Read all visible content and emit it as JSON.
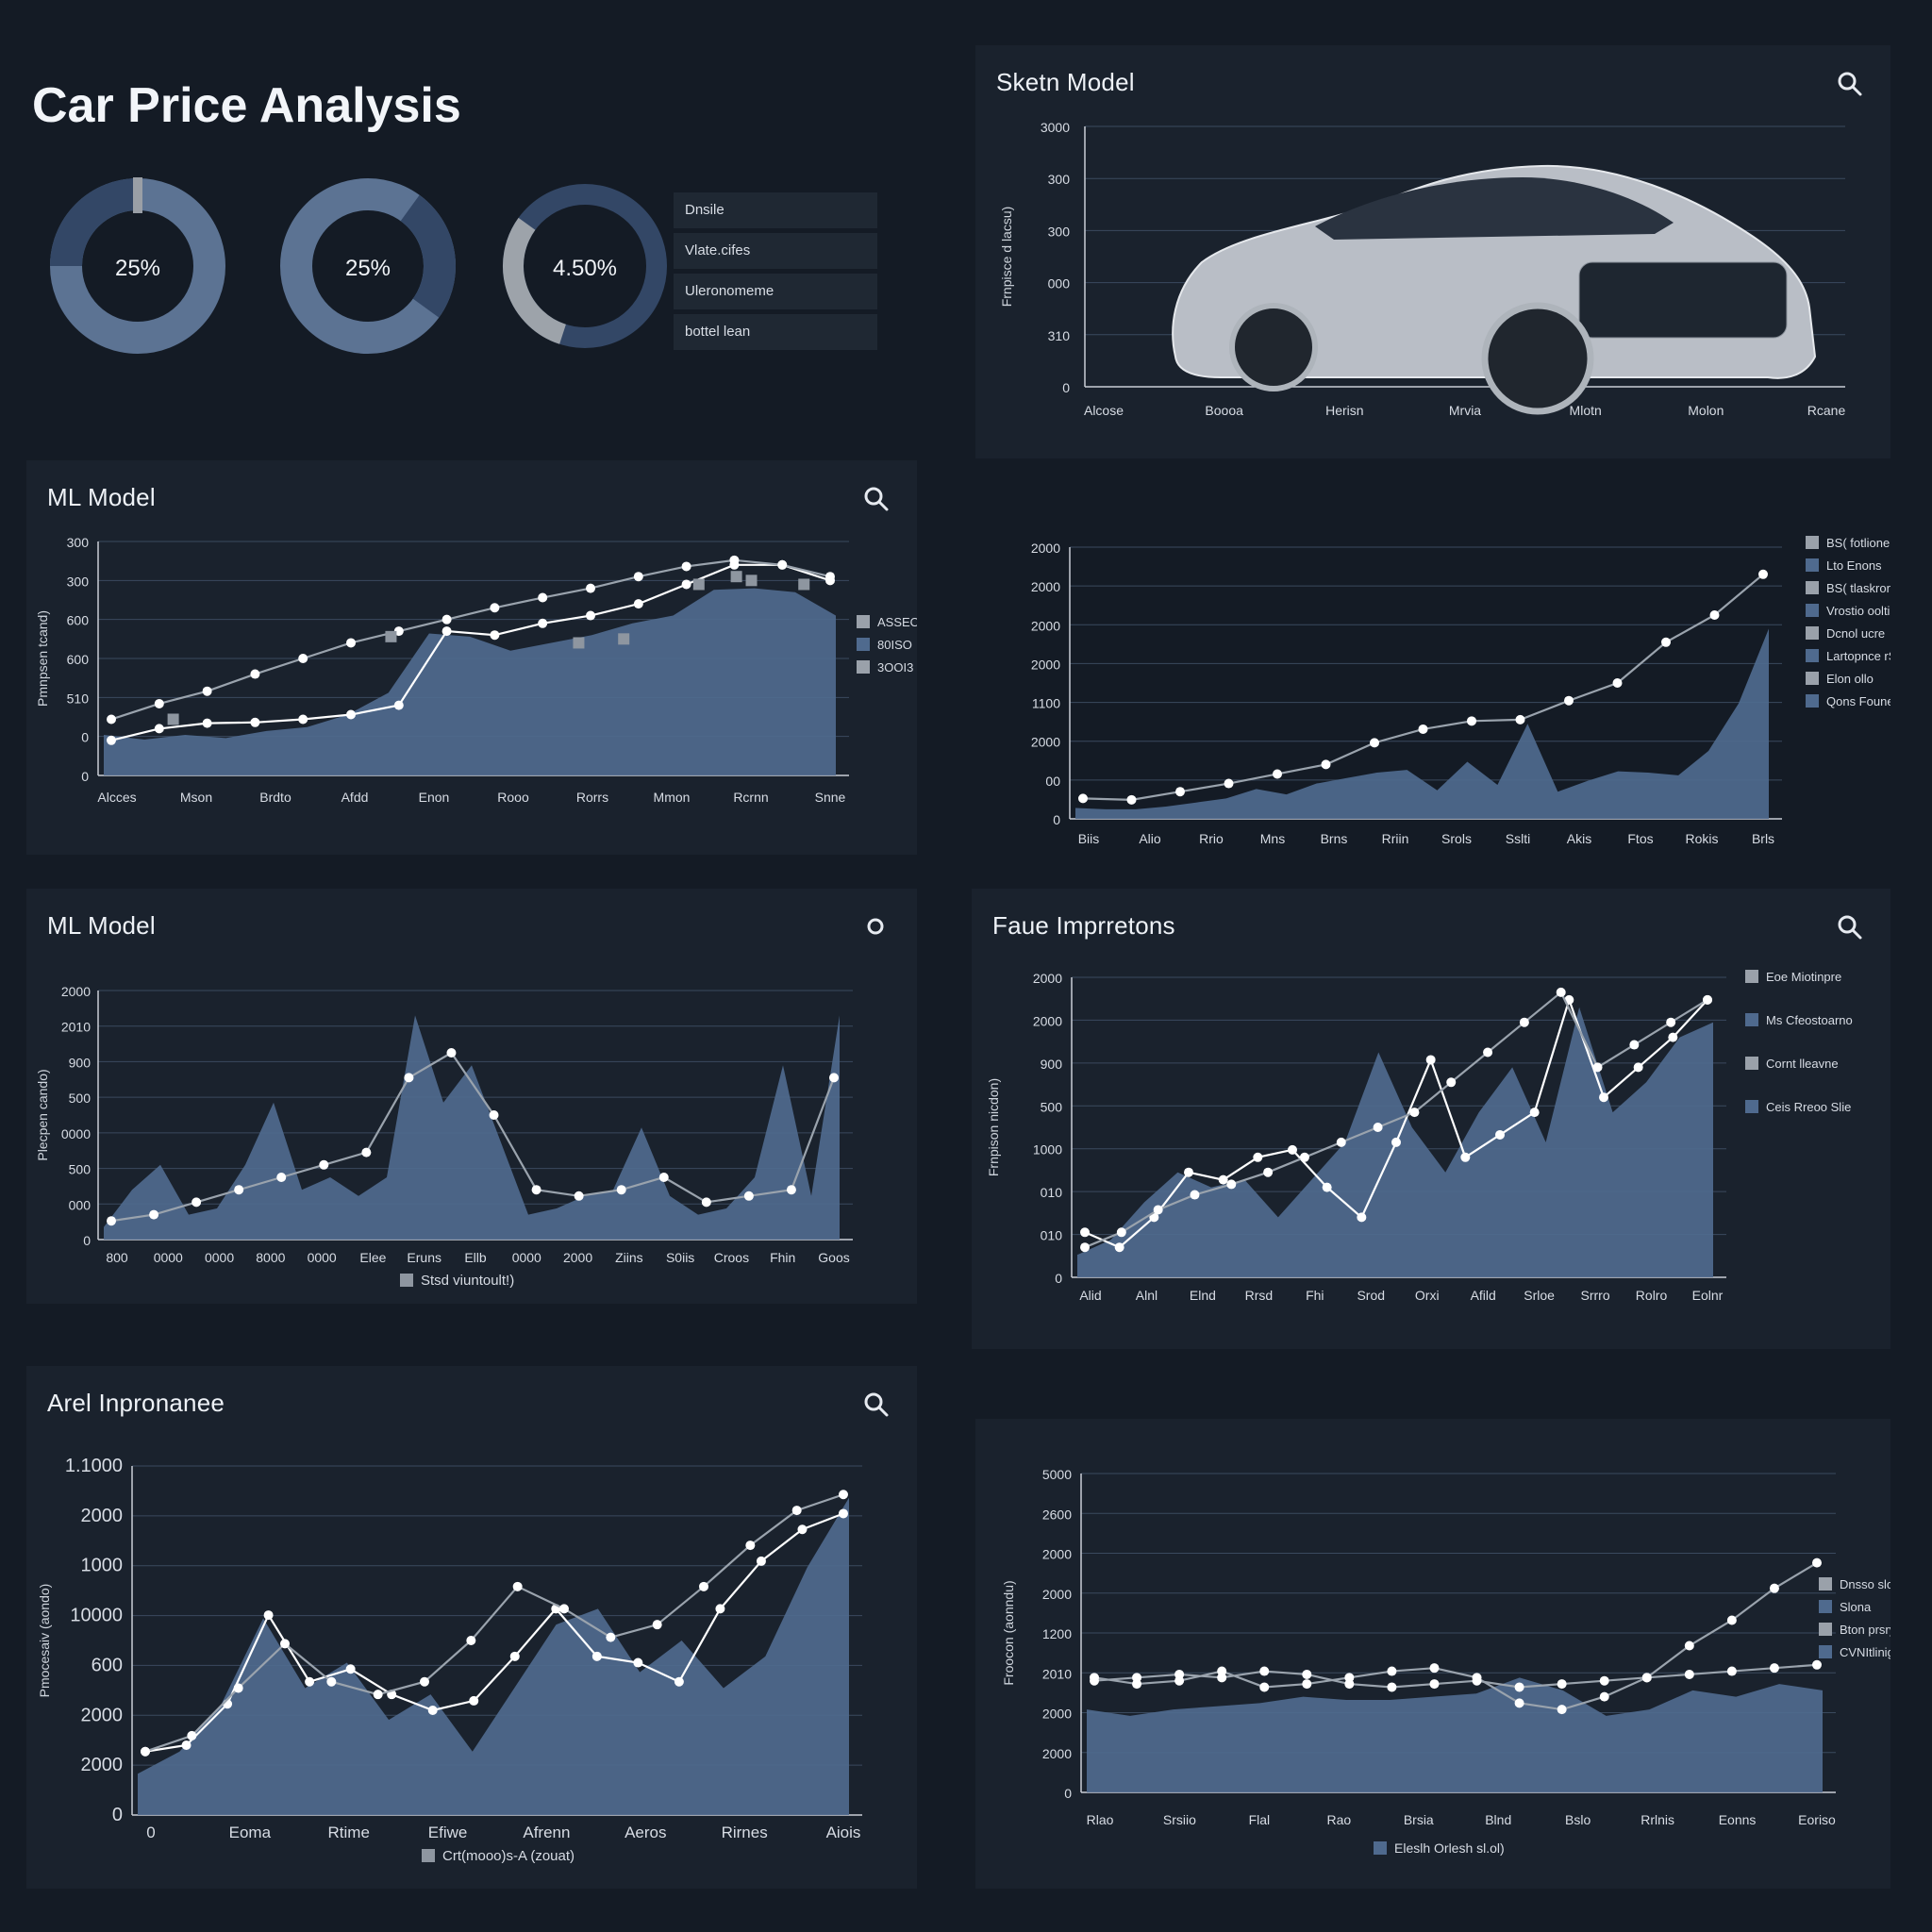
{
  "title": "Car Price Analysis",
  "gauges": [
    {
      "label": "25%",
      "fraction": 0.25
    },
    {
      "label": "25%",
      "fraction": 0.25
    },
    {
      "label": "4.50%",
      "fraction": 0.3
    }
  ],
  "gauge_legend": [
    "Dnsile",
    "Vlate.cifes",
    "Uleronomeme",
    "bottel lean"
  ],
  "colors": {
    "fill": "#4f6a8e",
    "line_white": "#ffffff",
    "line_gray": "#9aa3ad",
    "grid": "#3a4a5e",
    "bg": "#141b25",
    "panel": "#1a222d"
  },
  "icons": {
    "search": "search-icon"
  },
  "chart_data": [
    {
      "type": "bar",
      "panel_title": "Sketn Model",
      "ylabel": "Frnpisce d lacsu)",
      "categories": [
        "Alcose",
        "Boooa",
        "Herisn",
        "Mrvia",
        "Mlotn",
        "Molon",
        "Rcane"
      ],
      "y_ticks": [
        "3000",
        "300",
        "300",
        "000",
        "310",
        "0"
      ],
      "image": "car-photo"
    },
    {
      "type": "area",
      "panel_title": "ML Model",
      "ylabel": "Pmnpsen tcand)",
      "categories": [
        "Alcces",
        "Mson",
        "Brdto",
        "Afdd",
        "Enon",
        "Rooo",
        "Rorrs",
        "Mmon",
        "Rcrnn",
        "Snne"
      ],
      "y_ticks": [
        "300",
        "300",
        "600",
        "600",
        "510",
        "0",
        "0"
      ],
      "ylim": [
        0,
        300
      ],
      "area": [
        52,
        46,
        52,
        48,
        57,
        62,
        78,
        106,
        182,
        178,
        160,
        170,
        180,
        195,
        205,
        238,
        240,
        235,
        205
      ],
      "series": [
        {
          "color": "white",
          "values": [
            45,
            60,
            67,
            68,
            72,
            78,
            90,
            185,
            180,
            195,
            205,
            220,
            245,
            270,
            270,
            250
          ]
        },
        {
          "color": "gray",
          "values": [
            72,
            92,
            108,
            130,
            150,
            170,
            185,
            200,
            215,
            228,
            240,
            255,
            268,
            276,
            270,
            255
          ]
        }
      ],
      "markers_gray": [
        [
          0.1,
          72
        ],
        [
          0.39,
          178
        ],
        [
          0.64,
          170
        ],
        [
          0.7,
          175
        ],
        [
          0.8,
          245
        ],
        [
          0.85,
          255
        ],
        [
          0.87,
          250
        ],
        [
          0.94,
          245
        ]
      ],
      "legend": [
        "ASSEO",
        "80ISO",
        "3OOI3"
      ]
    },
    {
      "type": "area",
      "panel_title": "",
      "categories": [
        "Biis",
        "Alio",
        "Rrio",
        "Mns",
        "Brns",
        "Rriin",
        "Srols",
        "Sslti",
        "Akis",
        "Ftos",
        "Rokis",
        "Brls"
      ],
      "y_ticks": [
        "2000",
        "2000",
        "2000",
        "2000",
        "1100",
        "2000",
        "00",
        "0"
      ],
      "ylim": [
        0,
        2000
      ],
      "area": [
        80,
        70,
        70,
        90,
        120,
        150,
        220,
        180,
        260,
        300,
        340,
        360,
        210,
        420,
        250,
        700,
        200,
        280,
        350,
        340,
        320,
        500,
        850,
        1400
      ],
      "series": [
        {
          "color": "gray",
          "values": [
            150,
            140,
            200,
            260,
            330,
            400,
            560,
            660,
            720,
            730,
            870,
            1000,
            1300,
            1500,
            1800
          ]
        }
      ],
      "legend": [
        "BS( fotlione",
        "Lto Enons",
        "BS( tlaskronsy",
        "Vrostio ooltis",
        "Dcnol ucre",
        "Lartopnce rShl",
        "Elon ollo",
        "Qons Foune"
      ]
    },
    {
      "type": "area",
      "panel_title": "ML Model",
      "ylabel": "Plecpen cando)",
      "categories": [
        "800",
        "0000",
        "0000",
        "8000",
        "0000",
        "Elee",
        "Eruns",
        "Ellb",
        "0000",
        "2000",
        "Ziins",
        "S0iis",
        "Croos",
        "Fhin",
        "Goos"
      ],
      "y_ticks": [
        "2000",
        "2010",
        "900",
        "500",
        "0000",
        "500",
        "000",
        "0"
      ],
      "ylim": [
        0,
        2000
      ],
      "area": [
        100,
        400,
        600,
        200,
        250,
        600,
        1100,
        400,
        500,
        350,
        500,
        1800,
        1100,
        1400,
        800,
        200,
        250,
        350,
        400,
        900,
        350,
        200,
        250,
        500,
        1400,
        350,
        1800
      ],
      "series": [
        {
          "color": "gray",
          "values": [
            150,
            200,
            300,
            400,
            500,
            600,
            700,
            1300,
            1500,
            1000,
            400,
            350,
            400,
            500,
            300,
            350,
            400,
            1300
          ]
        }
      ],
      "legend": [
        "Stsd viuntoult!)"
      ]
    },
    {
      "type": "area",
      "panel_title": "Faue Imprretons",
      "ylabel": "Frnpison nicdon)",
      "categories": [
        "Alid",
        "Alnl",
        "Elnd",
        "Rrsd",
        "Fhi",
        "Srod",
        "Orxi",
        "Afild",
        "Srloe",
        "Srrro",
        "Rolro",
        "Eolnr"
      ],
      "y_ticks": [
        "2000",
        "2000",
        "900",
        "500",
        "1000",
        "010",
        "010",
        "0"
      ],
      "ylim": [
        0,
        2000
      ],
      "area": [
        150,
        250,
        500,
        700,
        600,
        650,
        400,
        650,
        900,
        1500,
        1000,
        700,
        1100,
        1400,
        900,
        1800,
        1100,
        1300,
        1600,
        1700
      ],
      "series": [
        {
          "color": "white",
          "values": [
            300,
            200,
            400,
            700,
            650,
            800,
            850,
            600,
            400,
            900,
            1450,
            800,
            950,
            1100,
            1850,
            1200,
            1400,
            1600,
            1850
          ]
        },
        {
          "color": "gray",
          "values": [
            200,
            300,
            450,
            550,
            620,
            700,
            800,
            900,
            1000,
            1100,
            1300,
            1500,
            1700,
            1900,
            1400,
            1550,
            1700,
            1850
          ]
        }
      ],
      "legend": [
        "Eoe Miotinpre",
        "Ms Cfeostoarno",
        "Cornt lleavne",
        "Ceis Rreoo Slie"
      ]
    },
    {
      "type": "area",
      "panel_title": "Arel Inpronanee",
      "ylabel": "Pmocesaiv (aondo)",
      "categories": [
        "0",
        "Eoma",
        "Rtime",
        "Efiwe",
        "Afrenn",
        "Aeros",
        "Rirnes",
        "Aiois"
      ],
      "y_ticks": [
        "1.1000",
        "2000",
        "1000",
        "10000",
        "600",
        "2000",
        "2000",
        "0"
      ],
      "ylim": [
        0,
        1100
      ],
      "area": [
        130,
        200,
        350,
        620,
        400,
        480,
        300,
        380,
        200,
        400,
        600,
        650,
        450,
        550,
        400,
        500,
        780,
        1000
      ],
      "series": [
        {
          "color": "white",
          "values": [
            200,
            220,
            350,
            630,
            420,
            460,
            380,
            330,
            360,
            500,
            650,
            500,
            480,
            420,
            650,
            800,
            900,
            950
          ]
        },
        {
          "color": "gray",
          "values": [
            200,
            250,
            400,
            540,
            420,
            380,
            420,
            550,
            720,
            650,
            560,
            600,
            720,
            850,
            960,
            1010
          ]
        }
      ],
      "legend": [
        "Crt(mooo)s-A (zouat)"
      ]
    },
    {
      "type": "area",
      "panel_title": "",
      "ylabel": "Froocon (aonndu)",
      "categories": [
        "Rlao",
        "Srsiio",
        "Flal",
        "Rao",
        "Brsia",
        "Blnd",
        "Bslo",
        "Rrlnis",
        "Eonns",
        "Eoriso"
      ],
      "y_ticks": [
        "5000",
        "2600",
        "2000",
        "2000",
        "1200",
        "2010",
        "2000",
        "2000",
        "0"
      ],
      "ylim": [
        0,
        5000
      ],
      "area": [
        1300,
        1200,
        1300,
        1350,
        1400,
        1500,
        1450,
        1450,
        1500,
        1550,
        1800,
        1600,
        1200,
        1300,
        1600,
        1500,
        1700,
        1600
      ],
      "series": [
        {
          "color": "gray",
          "values": [
            1800,
            1700,
            1750,
            1900,
            1650,
            1700,
            1800,
            1900,
            1950,
            1800,
            1400,
            1300,
            1500,
            1800,
            2300,
            2700,
            3200,
            3600
          ]
        },
        {
          "color": "gray",
          "values": [
            1750,
            1800,
            1850,
            1800,
            1900,
            1850,
            1700,
            1650,
            1700,
            1750,
            1650,
            1700,
            1750,
            1800,
            1850,
            1900,
            1950,
            2000
          ]
        }
      ],
      "legend": [
        "Dnsso slorer",
        "Slona",
        "Bton prsry",
        "CVNItlinig"
      ],
      "footer_legend": "Eleslh Orlesh sl.ol)"
    }
  ]
}
